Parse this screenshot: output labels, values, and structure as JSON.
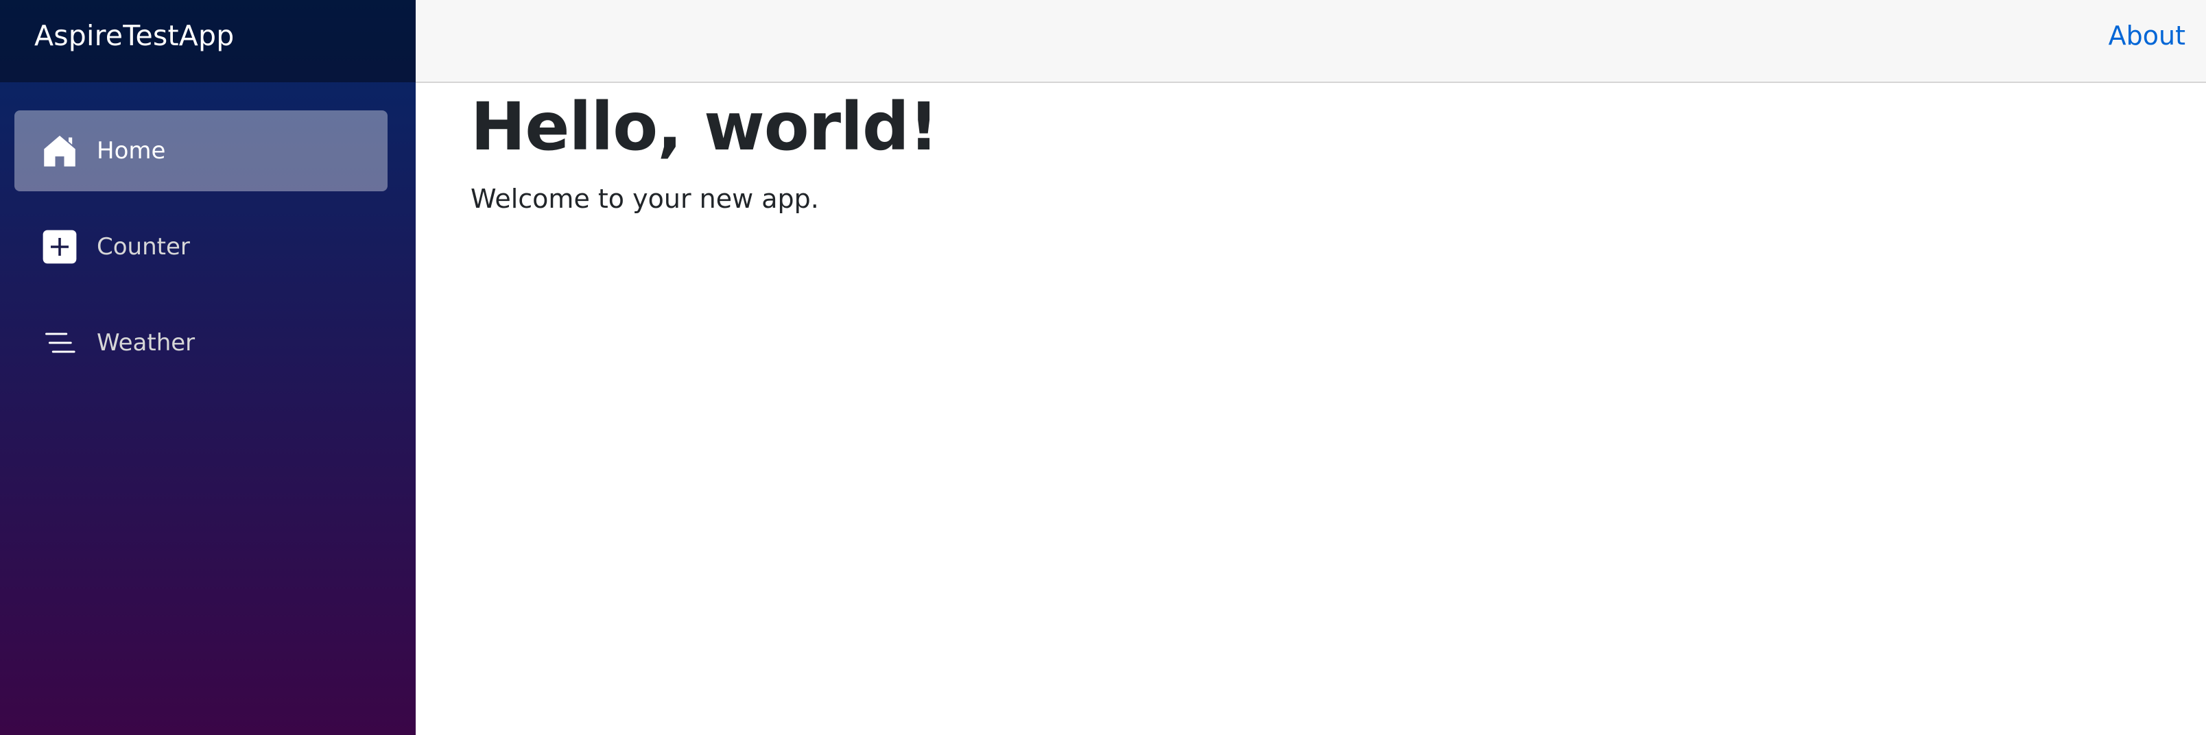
{
  "app": {
    "brand": "AspireTestApp"
  },
  "sidebar": {
    "items": [
      {
        "label": "Home",
        "icon": "home-icon",
        "active": true
      },
      {
        "label": "Counter",
        "icon": "plus-square-icon",
        "active": false
      },
      {
        "label": "Weather",
        "icon": "list-icon",
        "active": false
      }
    ]
  },
  "topbar": {
    "about_label": "About"
  },
  "main": {
    "title": "Hello, world!",
    "text": "Welcome to your new app."
  },
  "colors": {
    "sidebar_top": "#052767",
    "sidebar_bottom": "#3a0647",
    "link": "#0366d6",
    "topbar_bg": "#f7f7f7",
    "text": "#212529"
  }
}
